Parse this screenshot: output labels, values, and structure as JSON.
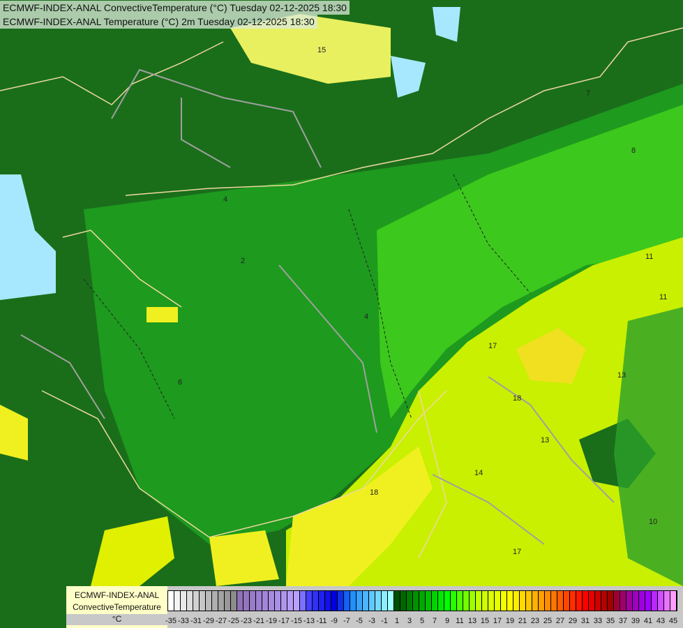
{
  "titles": [
    "ECMWF-INDEX-ANAL ConvectiveTemperature (°C) Tuesday 02-12-2025 18:30",
    "ECMWF-INDEX-ANAL Temperature (°C) 2m Tuesday 02-12-2025 18:30"
  ],
  "legend": {
    "line1": "ECMWF-INDEX-ANAL",
    "line2": "ConvectiveTemperature",
    "unit": "°C",
    "min": -35,
    "max": 45,
    "step": 1,
    "tick_labels": [
      "-35",
      "-33",
      "-31",
      "-29",
      "-27",
      "-25",
      "-23",
      "-21",
      "-19",
      "-17",
      "-15",
      "-13",
      "-11",
      "-9",
      "-7",
      "-5",
      "-3",
      "-1",
      "1",
      "3",
      "5",
      "7",
      "9",
      "11",
      "13",
      "15",
      "17",
      "19",
      "21",
      "23",
      "25",
      "27",
      "29",
      "31",
      "33",
      "35",
      "37",
      "39",
      "41",
      "43",
      "45"
    ],
    "color_stops": [
      {
        "v": -35,
        "c": "#ffffff"
      },
      {
        "v": -25,
        "c": "#8c8c8c"
      },
      {
        "v": -24,
        "c": "#9070b8"
      },
      {
        "v": -15,
        "c": "#b8a0ff"
      },
      {
        "v": -13,
        "c": "#4040ff"
      },
      {
        "v": -9,
        "c": "#0000e0"
      },
      {
        "v": -6,
        "c": "#2090ff"
      },
      {
        "v": 0,
        "c": "#a0ffff"
      },
      {
        "v": 1,
        "c": "#005000"
      },
      {
        "v": 9,
        "c": "#00ff00"
      },
      {
        "v": 14,
        "c": "#c0ff00"
      },
      {
        "v": 19,
        "c": "#ffff00"
      },
      {
        "v": 25,
        "c": "#ff8c00"
      },
      {
        "v": 31,
        "c": "#ff0000"
      },
      {
        "v": 35,
        "c": "#a00000"
      },
      {
        "v": 38,
        "c": "#a000a0"
      },
      {
        "v": 41,
        "c": "#a000ff"
      },
      {
        "v": 45,
        "c": "#ff9cff"
      }
    ]
  },
  "contour_labels": [
    "15",
    "4",
    "2",
    "6",
    "4",
    "7",
    "8",
    "11",
    "13",
    "17",
    "18",
    "14",
    "13",
    "11",
    "10",
    "17",
    "18"
  ],
  "colors": {
    "dark_green": "#1a6e1a",
    "mid_green": "#1e9a1e",
    "bright_green": "#3fd21c",
    "yellow_green": "#c8f000",
    "yellow": "#f0f020",
    "light_blue": "#a8e8ff",
    "border": "#f0d8a0",
    "contour_gray": "#a0a0a0"
  }
}
